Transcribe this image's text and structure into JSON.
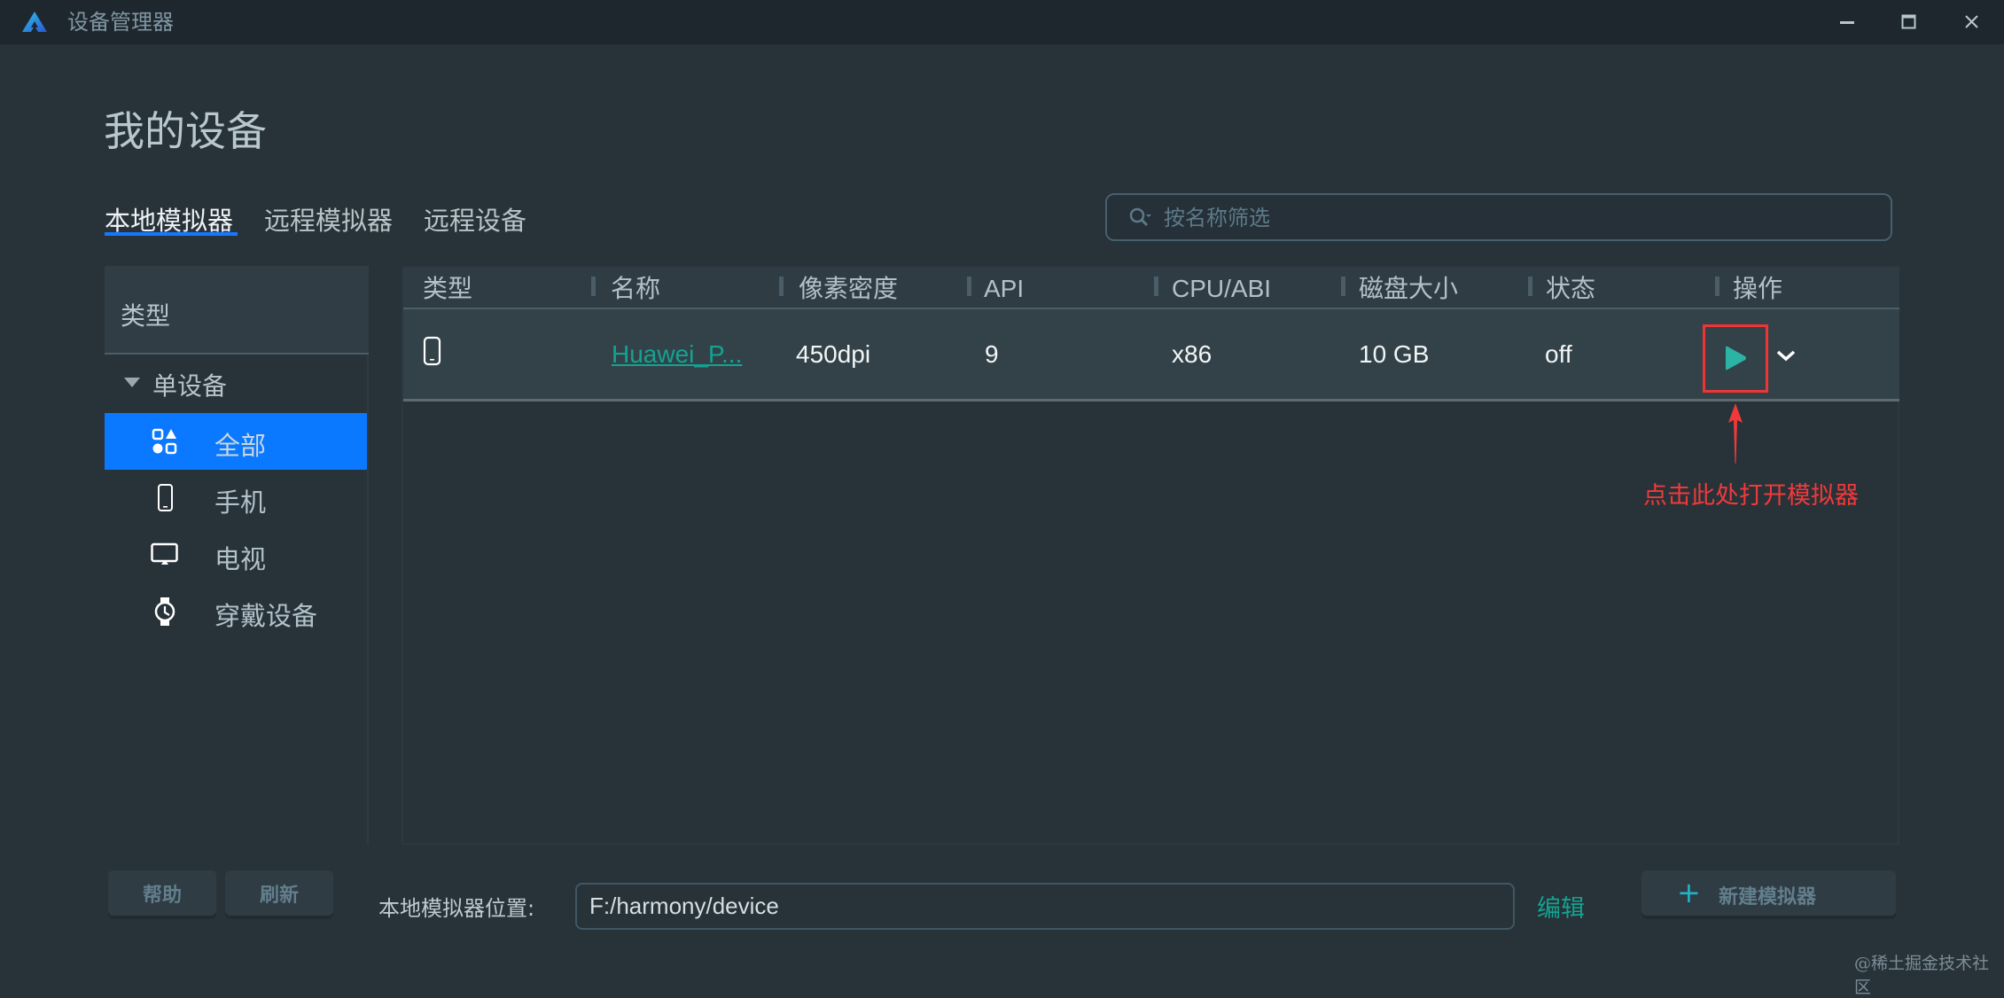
{
  "window": {
    "title": "设备管理器",
    "logo_icon": "deveco-logo-icon",
    "controls": {
      "minimize": "minimize-icon",
      "maximize": "maximize-icon",
      "close": "close-icon"
    }
  },
  "header": {
    "page_title": "我的设备",
    "tabs": [
      {
        "label": "本地模拟器",
        "active": true
      },
      {
        "label": "远程模拟器",
        "active": false
      },
      {
        "label": "远程设备",
        "active": false
      }
    ],
    "search": {
      "placeholder": "按名称筛选",
      "value": ""
    }
  },
  "sidebar": {
    "header": "类型",
    "group": {
      "label": "单设备",
      "expanded": true
    },
    "items": [
      {
        "label": "全部",
        "icon": "all-categories-icon",
        "selected": true
      },
      {
        "label": "手机",
        "icon": "phone-icon",
        "selected": false
      },
      {
        "label": "电视",
        "icon": "tv-icon",
        "selected": false
      },
      {
        "label": "穿戴设备",
        "icon": "watch-icon",
        "selected": false
      }
    ]
  },
  "table": {
    "columns": [
      "类型",
      "名称",
      "像素密度",
      "API",
      "CPU/ABI",
      "磁盘大小",
      "状态",
      "操作"
    ],
    "rows": [
      {
        "type_icon": "phone-icon",
        "name": "Huawei_P...",
        "density": "450dpi",
        "api": "9",
        "cpu_abi": "x86",
        "disk": "10 GB",
        "status": "off",
        "actions": [
          "play-icon",
          "chevron-down-icon"
        ]
      }
    ]
  },
  "annotation": {
    "text": "点击此处打开模拟器",
    "color": "#f03a3a"
  },
  "footer": {
    "help_label": "帮助",
    "refresh_label": "刷新",
    "location_label": "本地模拟器位置:",
    "location_value": "F:/harmony/device",
    "edit_label": "编辑",
    "new_emulator_label": "新建模拟器"
  },
  "watermark": "@稀土掘金技术社区",
  "colors": {
    "accent": "#0a78ff",
    "link": "#13a391",
    "play": "#2bb3a6",
    "highlight": "#ee3535"
  }
}
